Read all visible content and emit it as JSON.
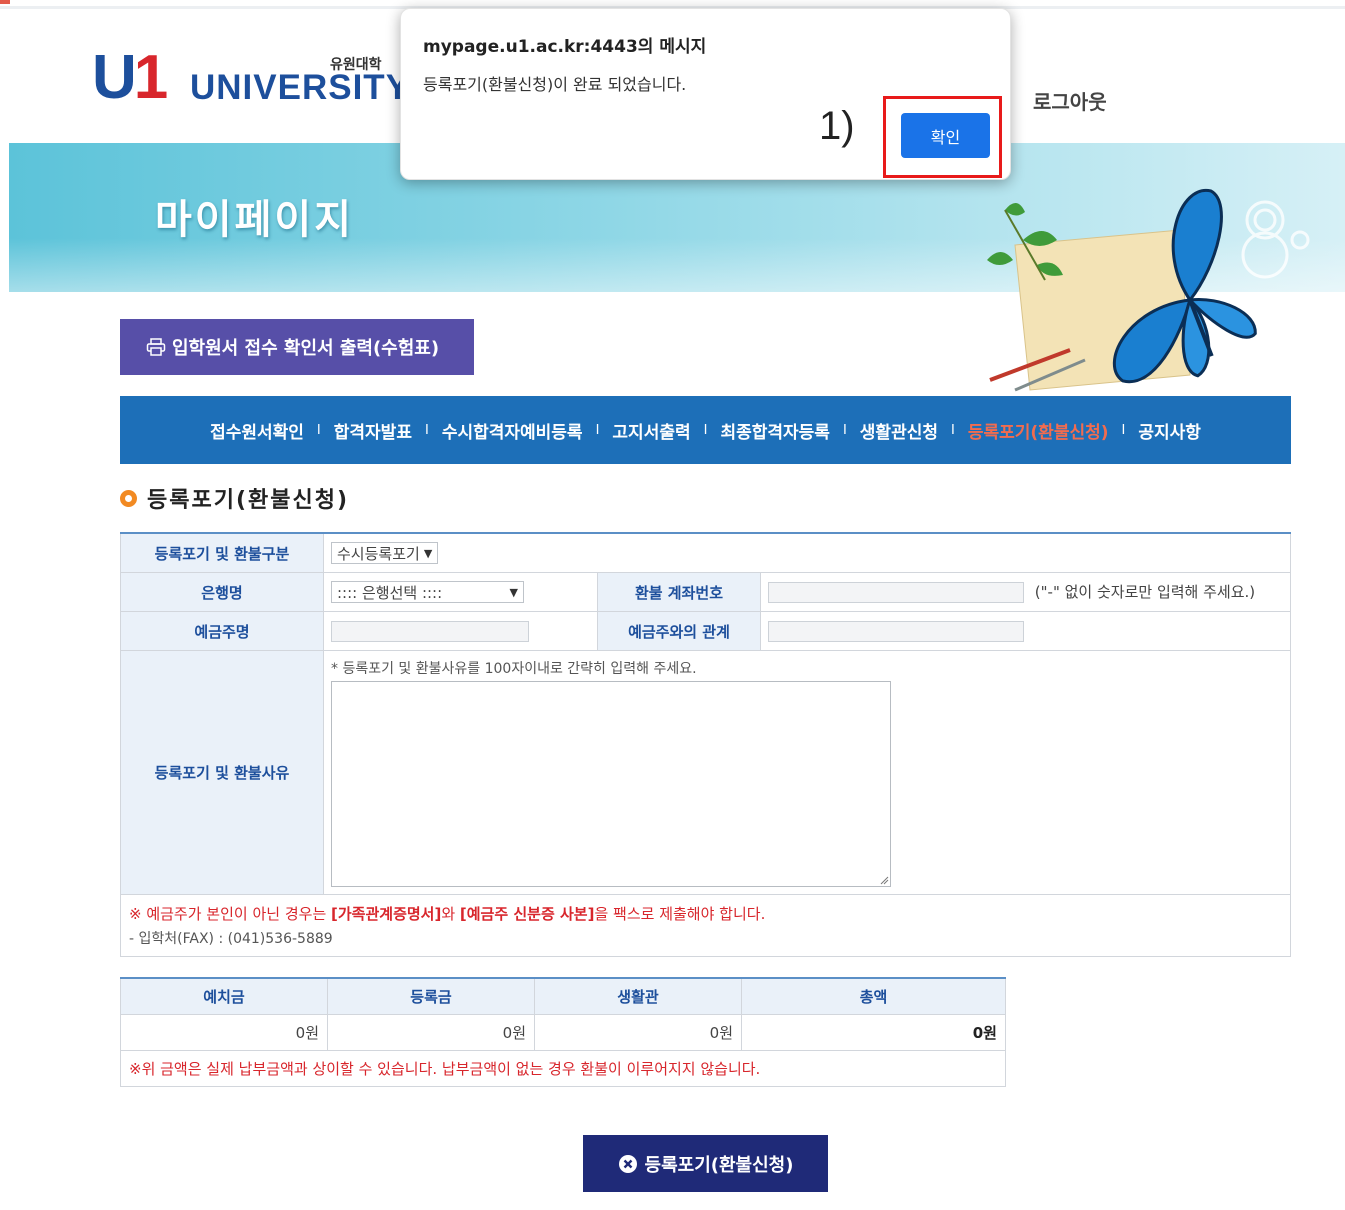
{
  "header": {
    "logo_main": "U1",
    "logo_univ": "UNIVERSITY",
    "logo_kor": "유원대학",
    "logout_label": "로그아웃"
  },
  "banner": {
    "title": "마이페이지"
  },
  "print_button": {
    "label": "입학원서 접수 확인서 출력(수험표)",
    "icon": "printer-icon"
  },
  "nav": {
    "separator": "I",
    "items": [
      {
        "label": "접수원서확인",
        "active": false
      },
      {
        "label": "합격자발표",
        "active": false
      },
      {
        "label": "수시합격자예비등록",
        "active": false
      },
      {
        "label": "고지서출력",
        "active": false
      },
      {
        "label": "최종합격자등록",
        "active": false
      },
      {
        "label": "생활관신청",
        "active": false
      },
      {
        "label": "등록포기(환불신청)",
        "active": true
      },
      {
        "label": "공지사항",
        "active": false
      }
    ]
  },
  "section": {
    "title": "등록포기(환불신청)"
  },
  "form": {
    "type_label": "등록포기 및 환불구분",
    "type_value": "수시등록포기",
    "bank_label": "은행명",
    "bank_value": ":::: 은행선택 ::::",
    "account_label": "환불 계좌번호",
    "account_value": "",
    "account_hint": "(\"-\" 없이 숫자로만 입력해 주세요.)",
    "holder_label": "예금주명",
    "holder_value": "",
    "relation_label": "예금주와의 관계",
    "relation_value": "",
    "reason_label": "등록포기 및 환불사유",
    "reason_note": "* 등록포기 및 환불사유를 100자이내로 간략히 입력해 주세요.",
    "reason_value": "",
    "notice_prefix": "※ 예금주가 본인이 아닌 경우는 ",
    "notice_doc1": "[가족관계증명서]",
    "notice_mid": "와 ",
    "notice_doc2": "[예금주 신분증 사본]",
    "notice_suffix": "을 팩스로 제출해야 합니다.",
    "fax_note": "- 입학처(FAX) : (041)536-5889"
  },
  "amount": {
    "headers": [
      "예치금",
      "등록금",
      "생활관",
      "총액"
    ],
    "values": [
      "0원",
      "0원",
      "0원",
      "0원"
    ],
    "note": "※위 금액은 실제 납부금액과 상이할 수 있습니다. 납부금액이 없는 경우 환불이 이루어지지 않습니다."
  },
  "submit": {
    "label": "등록포기(환불신청)",
    "icon": "x-circle-icon"
  },
  "dialog": {
    "title": "mypage.u1.ac.kr:4443의 메시지",
    "message": "등록포기(환불신청)이 완료 되었습니다.",
    "annotation": "1)",
    "ok_label": "확인",
    "highlight_color": "#e81a1a"
  },
  "colors": {
    "nav_bg": "#1d6fb8",
    "nav_active": "#f26c4f",
    "print_btn": "#574fa8",
    "submit_btn": "#1f2a78",
    "dialog_ok": "#1a73e8",
    "header_blue": "#1d4f9c",
    "notice_red": "#d8262c"
  }
}
